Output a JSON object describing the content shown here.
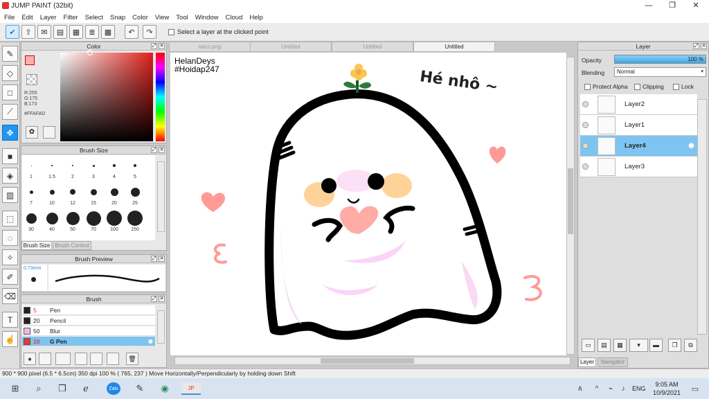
{
  "window": {
    "title": "JUMP PAINT (32bit)",
    "minimize": "—",
    "maximize": "❐",
    "close": "✕"
  },
  "menu": [
    "File",
    "Edit",
    "Layer",
    "Filter",
    "Select",
    "Snap",
    "Color",
    "View",
    "Tool",
    "Window",
    "Cloud",
    "Help"
  ],
  "toolbar": {
    "select_layer_label": "Select a layer at the clicked point"
  },
  "tabs": [
    {
      "label": "taico.png",
      "active": false
    },
    {
      "label": "Untitled",
      "active": false
    },
    {
      "label": "Untitled",
      "active": false
    },
    {
      "label": "Untitled",
      "active": true
    }
  ],
  "color_panel": {
    "title": "Color",
    "r": "R:255",
    "g": "G:175",
    "b": "B:173",
    "hex": "#FFAFAD",
    "primary": "#FFAFAD"
  },
  "brush_size_panel": {
    "title": "Brush Size",
    "sizes": [
      "1",
      "1.5",
      "2",
      "3",
      "4",
      "5",
      "7",
      "10",
      "12",
      "15",
      "20",
      "25",
      "30",
      "40",
      "50",
      "70",
      "100",
      "150"
    ],
    "tab_active": "Brush Size",
    "tab_inactive": "Brush Control"
  },
  "brush_preview": {
    "title": "Brush Preview",
    "size": "0.73mm"
  },
  "brush_panel": {
    "title": "Brush",
    "items": [
      {
        "size": "5",
        "name": "Pen",
        "color": "#222222"
      },
      {
        "size": "20",
        "name": "Pencil",
        "color": "#222222"
      },
      {
        "size": "50",
        "name": "Blur",
        "color": "#f0b6f0"
      },
      {
        "size": "10",
        "name": "G Pen",
        "color": "#e53935"
      }
    ]
  },
  "layer_panel": {
    "title": "Layer",
    "opacity_label": "Opacity",
    "opacity_value": "100 %",
    "opacity_fill": 1.0,
    "blending_label": "Blending",
    "blending_value": "Normal",
    "protect_alpha": "Protect Alpha",
    "clipping": "Clipping",
    "lock": "Lock",
    "layers": [
      {
        "name": "Layer2",
        "selected": false
      },
      {
        "name": "Layer1",
        "selected": false
      },
      {
        "name": "Layer4",
        "selected": true
      },
      {
        "name": "Layer3",
        "selected": false
      }
    ],
    "tab_active": "Layer",
    "tab_inactive": "Navigator"
  },
  "artwork": {
    "watermark_line1": "HelanDeys",
    "watermark_line2": "#Hoidap247",
    "caption": "Hé nhô ~"
  },
  "status": {
    "text": "900 * 900 pixel   (6.5 * 6.5cm)   350 dpi   100 %   ( 765, 237 )   Move Horizontally/Perpendicularly by holding down Shift"
  },
  "taskbar": {
    "lang": "ENG",
    "time": "9:05 AM",
    "date": "10/9/2021"
  }
}
